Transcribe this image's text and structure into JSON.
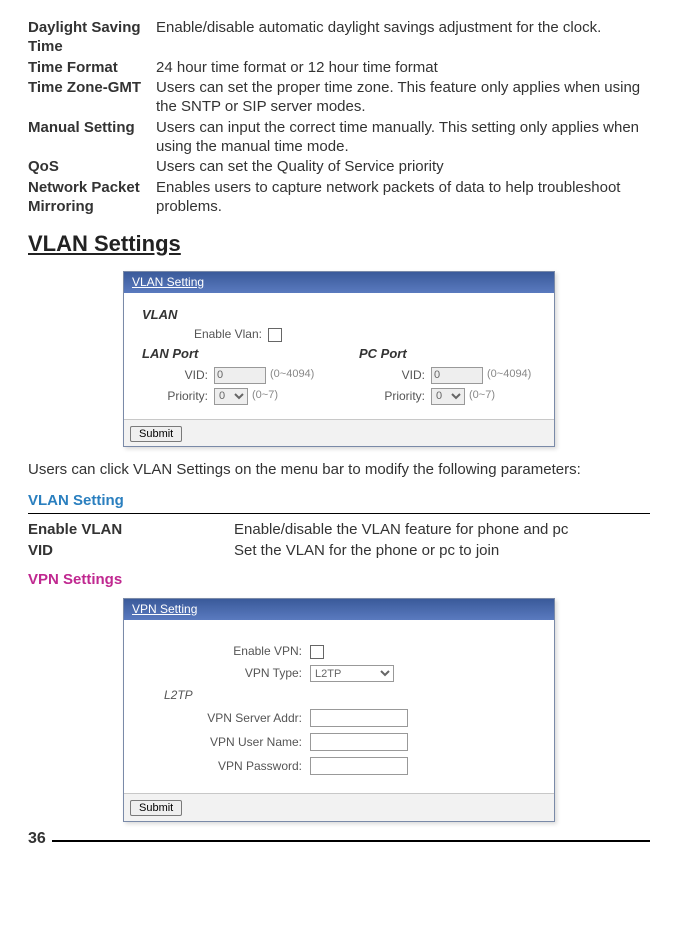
{
  "defs": [
    {
      "term": "Daylight Saving Time",
      "desc": "Enable/disable automatic daylight savings adjustment for the clock."
    },
    {
      "term": "Time Format",
      "desc": "24 hour time format or 12 hour time format"
    },
    {
      "term": "Time Zone-GMT",
      "desc": "Users can set the proper time zone.  This feature only applies when using the SNTP or SIP server modes."
    },
    {
      "term": "Manual Setting",
      "desc": "Users can input the correct time manually.  This setting only applies when using the manual time mode."
    },
    {
      "term": "QoS",
      "desc": "Users can set the Quality of Service priority"
    },
    {
      "term": "Network Packet Mirroring",
      "desc": "Enables users to capture network packets of data to help troubleshoot problems."
    }
  ],
  "vlan_heading": "VLAN Settings",
  "vlan_dialog": {
    "title": "VLAN Setting",
    "section_label": "VLAN",
    "enable_label": "Enable Vlan:",
    "lan_port_label": "LAN Port",
    "pc_port_label": "PC Port",
    "vid_label": "VID:",
    "vid_value": "0",
    "vid_range": "(0~4094)",
    "priority_label": "Priority:",
    "priority_value": "0",
    "priority_range": "(0~7)",
    "submit": "Submit"
  },
  "vlan_body_text": "Users can click VLAN Settings on the menu bar to modify the following parameters:",
  "vlan_setting_head": "VLAN Setting",
  "vlan_defs": [
    {
      "term": "Enable VLAN",
      "desc": "Enable/disable the VLAN feature for phone and pc"
    },
    {
      "term": "VID",
      "desc": "Set the VLAN for the phone or pc to join"
    }
  ],
  "vpn_heading": "VPN Settings",
  "vpn_dialog": {
    "title": "VPN Setting",
    "enable_label": "Enable VPN:",
    "type_label": "VPN Type:",
    "type_value": "L2TP",
    "l2tp_label": "L2TP",
    "server_label": "VPN Server Addr:",
    "user_label": "VPN User Name:",
    "pass_label": "VPN Password:",
    "submit": "Submit"
  },
  "page_number": "36"
}
